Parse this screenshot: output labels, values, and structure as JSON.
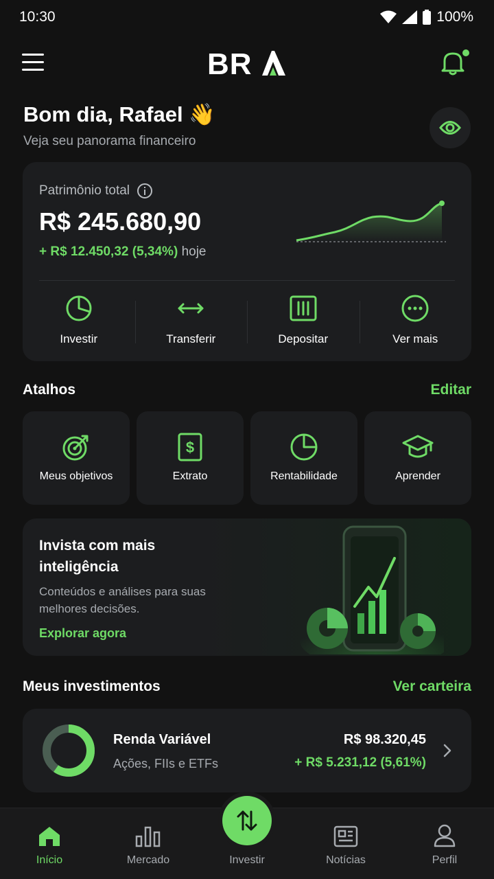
{
  "status_bar": {
    "time": "10:30",
    "battery": "100%"
  },
  "header": {
    "logo": "BRA"
  },
  "greeting": {
    "title": "Bom dia, Rafael 👋",
    "subtitle": "Veja seu panorama financeiro"
  },
  "portfolio": {
    "label": "Patrimônio total",
    "value": "R$ 245.680,90",
    "change": "+ R$ 12.450,32 (5,34%)",
    "change_suffix": "hoje",
    "actions": [
      {
        "label": "Investir",
        "icon": "pie-chart-icon"
      },
      {
        "label": "Transferir",
        "icon": "transfer-arrows-icon"
      },
      {
        "label": "Depositar",
        "icon": "deposit-icon"
      },
      {
        "label": "Ver mais",
        "icon": "more-icon"
      }
    ]
  },
  "shortcuts": {
    "title": "Atalhos",
    "edit_label": "Editar",
    "items": [
      {
        "label": "Meus objetivos",
        "icon": "target-icon"
      },
      {
        "label": "Extrato",
        "icon": "statement-icon"
      },
      {
        "label": "Rentabilidade",
        "icon": "pie-chart-icon"
      },
      {
        "label": "Aprender",
        "icon": "graduation-cap-icon"
      }
    ]
  },
  "promo": {
    "title": "Invista com mais inteligência",
    "subtitle": "Conteúdos e análises para suas melhores decisões.",
    "link": "Explorar agora"
  },
  "investments": {
    "title": "Meus investimentos",
    "link": "Ver carteira",
    "items": [
      {
        "name": "Renda Variável",
        "subtitle": "Ações, FIIs e ETFs",
        "value": "R$ 98.320,45",
        "change": "+ R$ 5.231,12 (5,61%)"
      }
    ]
  },
  "bottom_nav": {
    "items": [
      {
        "label": "Início",
        "icon": "home-icon",
        "active": true
      },
      {
        "label": "Mercado",
        "icon": "bar-chart-icon",
        "active": false
      },
      {
        "label": "Investir",
        "icon": "swap-vertical-icon",
        "active": false
      },
      {
        "label": "Notícias",
        "icon": "newspaper-icon",
        "active": false
      },
      {
        "label": "Perfil",
        "icon": "user-icon",
        "active": false
      }
    ]
  },
  "colors": {
    "accent": "#6fdb66",
    "background": "#121212",
    "card": "#1c1d1f",
    "muted": "#a7abb0"
  }
}
